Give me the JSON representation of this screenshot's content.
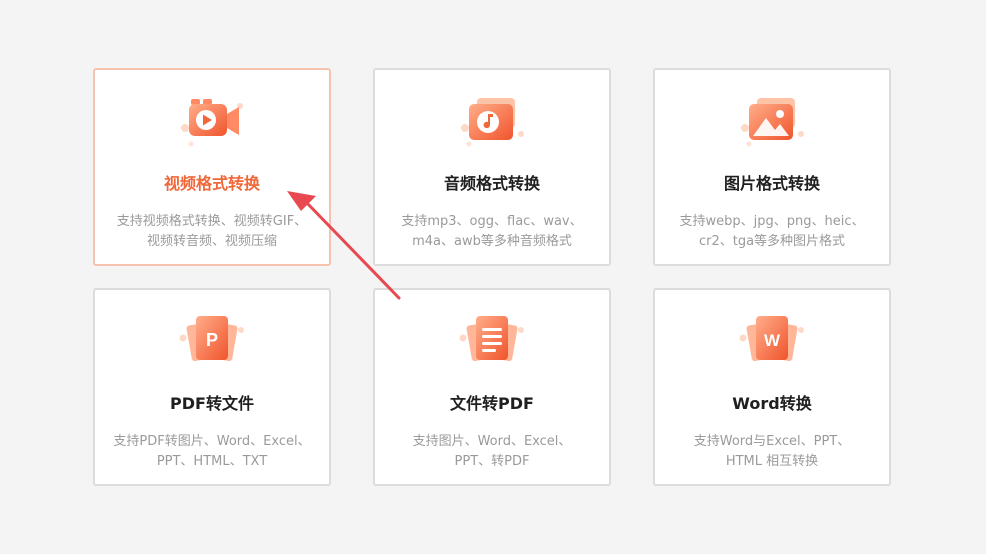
{
  "colors": {
    "accent": "#f0683a",
    "accent_light": "#ffb08f",
    "active_border": "#f6c4ae",
    "arrow": "#e8484f"
  },
  "cards": [
    {
      "title": "视频格式转换",
      "desc_line1": "支持视频格式转换、视频转GIF、",
      "desc_line2": "视频转音频、视频压缩",
      "icon": "video-camera-icon",
      "active": true
    },
    {
      "title": "音频格式转换",
      "desc_line1": "支持mp3、ogg、flac、wav、",
      "desc_line2": "m4a、awb等多种音频格式",
      "icon": "music-note-icon",
      "active": false
    },
    {
      "title": "图片格式转换",
      "desc_line1": "支持webp、jpg、png、heic、",
      "desc_line2": "cr2、tga等多种图片格式",
      "icon": "image-icon",
      "active": false
    },
    {
      "title": "PDF转文件",
      "desc_line1": "支持PDF转图片、Word、Excel、",
      "desc_line2": "PPT、HTML、TXT",
      "icon": "ppt-file-icon",
      "glyph": "P",
      "active": false
    },
    {
      "title": "文件转PDF",
      "desc_line1": "支持图片、Word、Excel、",
      "desc_line2": "PPT、转PDF",
      "icon": "document-icon",
      "active": false
    },
    {
      "title": "Word转换",
      "desc_line1": "支持Word与Excel、PPT、",
      "desc_line2": "HTML 相互转换",
      "icon": "word-file-icon",
      "glyph": "W",
      "active": false
    }
  ]
}
